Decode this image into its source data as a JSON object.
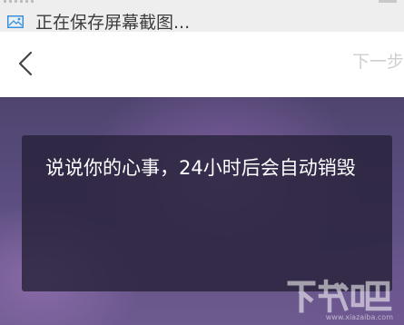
{
  "status_bar": {
    "notification_text": "正在保存屏幕截图..."
  },
  "nav": {
    "next_label": "下一步"
  },
  "editor": {
    "placeholder": "说说你的心事，24小时后会自动销毁"
  },
  "watermark": {
    "brand": "下载吧",
    "url": "www.xiazaiba.com"
  },
  "colors": {
    "nav_background": "#ffffff",
    "next_label_disabled": "#cfcfcf",
    "card_background": "#28223a",
    "backdrop_base": "#5a4d7e"
  },
  "icons": {
    "notification": "image-icon",
    "back": "chevron-left-icon"
  }
}
